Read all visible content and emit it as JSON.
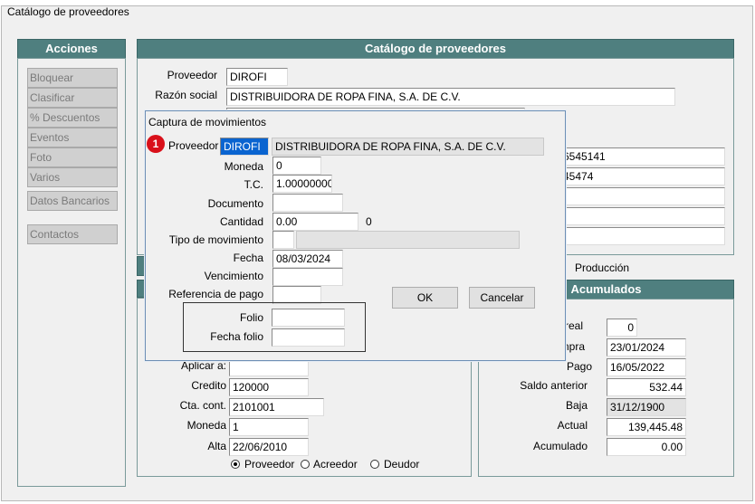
{
  "window": {
    "title": "Catálogo de proveedores"
  },
  "acciones": {
    "header": "Acciones",
    "buttons": [
      "Bloquear",
      "Clasificar",
      "% Descuentos",
      "Eventos",
      "Foto",
      "Varios",
      "Datos Bancarios",
      "Contactos"
    ]
  },
  "catalogo": {
    "header": "Catálogo de proveedores",
    "proveedor_label": "Proveedor",
    "proveedor_value": "DIROFI",
    "razon_label": "Razón social",
    "razon_value": "DISTRIBUIDORA DE ROPA FINA, S.A. DE C.V.",
    "phone1": "6545141",
    "phone2": "45474",
    "tab_produccion": "Producción"
  },
  "datos": {
    "aplicar_label": "Aplicar a:",
    "aplicar_value": "",
    "credito_label": "Credito",
    "credito_value": "120000",
    "cta_label": "Cta. cont.",
    "cta_value": "2101001",
    "moneda_label": "Moneda",
    "moneda_value": "1",
    "alta_label": "Alta",
    "alta_value": "22/06/2010",
    "radio_proveedor": "Proveedor",
    "radio_acreedor": "Acreedor",
    "radio_deudor": "Deudor"
  },
  "acumulados": {
    "header": "Acumulados",
    "real_label": "real",
    "real_value": "0",
    "compra_label": "mpra",
    "compra_value": "23/01/2024",
    "pago_label": "Pago",
    "pago_value": "16/05/2022",
    "saldo_label": "Saldo anterior",
    "saldo_value": "532.44",
    "baja_label": "Baja",
    "baja_value": "31/12/1900",
    "actual_label": "Actual",
    "actual_value": "139,445.48",
    "acumulado_label": "Acumulado",
    "acumulado_value": "0.00"
  },
  "dialog": {
    "title": "Captura de movimientos",
    "badge": "1",
    "proveedor_label": "Proveedor",
    "proveedor_value": "DIROFI",
    "proveedor_name": "DISTRIBUIDORA DE ROPA FINA, S.A. DE C.V.",
    "moneda_label": "Moneda",
    "moneda_value": "0",
    "tc_label": "T.C.",
    "tc_value": "1.00000000",
    "documento_label": "Documento",
    "documento_value": "",
    "cantidad_label": "Cantidad",
    "cantidad_value": "0.00",
    "cantidad_extra": "0",
    "tipo_label": "Tipo de movimiento",
    "fecha_label": "Fecha",
    "fecha_value": "08/03/2024",
    "venc_label": "Vencimiento",
    "ref_label": "Referencia de pago",
    "folio_label": "Folio",
    "fecha_folio_label": "Fecha folio",
    "ok_label": "OK",
    "cancel_label": "Cancelar"
  }
}
